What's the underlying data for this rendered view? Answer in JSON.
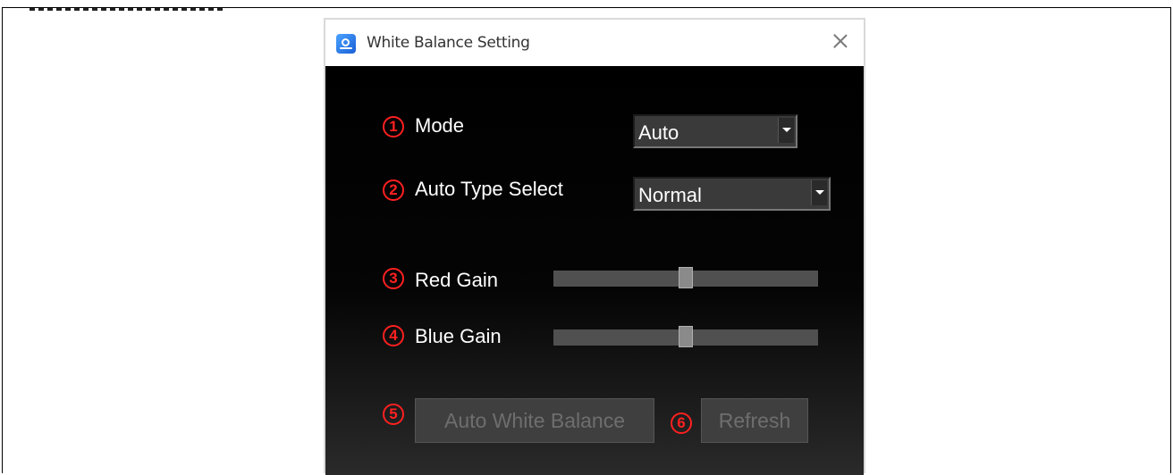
{
  "window": {
    "title": "White Balance Setting",
    "app_icon": "camera-app-icon",
    "close_icon": "close-icon"
  },
  "markers": [
    "1",
    "2",
    "3",
    "4",
    "5",
    "6"
  ],
  "mode": {
    "label": "Mode",
    "value": "Auto"
  },
  "auto_type": {
    "label": "Auto Type Select",
    "value": "Normal"
  },
  "red_gain": {
    "label": "Red Gain",
    "level_fraction": 0.5
  },
  "blue_gain": {
    "label": "Blue Gain",
    "level_fraction": 0.5
  },
  "buttons": {
    "auto_white_balance": "Auto White Balance",
    "refresh": "Refresh"
  },
  "colors": {
    "marker": "#ff2020",
    "disabled_text": "#6e6e6e"
  }
}
